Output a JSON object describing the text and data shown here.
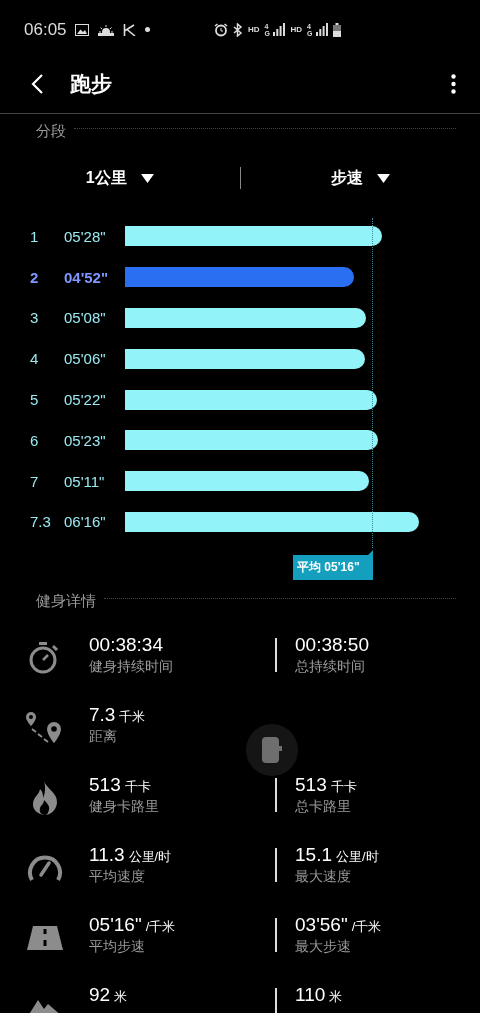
{
  "status_bar": {
    "time": "06:05",
    "left_icons": [
      {
        "kind": "image"
      },
      {
        "kind": "weather"
      },
      {
        "kind": "k"
      },
      {
        "kind": "dot"
      }
    ],
    "right_items": [
      {
        "kind": "alarm"
      },
      {
        "kind": "bluetooth"
      },
      {
        "kind": "hd",
        "text": "HD"
      },
      {
        "kind": "signal",
        "text": "4G"
      },
      {
        "kind": "hd",
        "text": "HD"
      },
      {
        "kind": "signal",
        "text": "4G"
      },
      {
        "kind": "battery"
      }
    ]
  },
  "header": {
    "title": "跑步"
  },
  "splits": {
    "title": "分段",
    "filters": [
      {
        "label": "1公里"
      },
      {
        "label": "步速"
      }
    ],
    "rows": [
      {
        "index": "1",
        "pace": "05'28\"",
        "selected": false
      },
      {
        "index": "2",
        "pace": "04'52\"",
        "selected": true
      },
      {
        "index": "3",
        "pace": "05'08\"",
        "selected": false
      },
      {
        "index": "4",
        "pace": "05'06\"",
        "selected": false
      },
      {
        "index": "5",
        "pace": "05'22\"",
        "selected": false
      },
      {
        "index": "6",
        "pace": "05'23\"",
        "selected": false
      },
      {
        "index": "7",
        "pace": "05'11\"",
        "selected": false
      },
      {
        "index": "7.3",
        "pace": "06'16\"",
        "selected": false
      }
    ],
    "average": {
      "label": "平均 05'16\""
    }
  },
  "details": {
    "title": "健身详情",
    "rows": [
      {
        "kind": "stopwatch",
        "left": {
          "value": "00:38:34",
          "label": "健身持续时间"
        },
        "right": {
          "value": "00:38:50",
          "label": "总持续时间"
        }
      },
      {
        "kind": "route",
        "left": {
          "value": "7.3",
          "unit": "千米",
          "label": "距离"
        }
      },
      {
        "kind": "flame",
        "left": {
          "value": "513",
          "unit": "千卡",
          "label": "健身卡路里"
        },
        "right": {
          "value": "513",
          "unit": "千卡",
          "label": "总卡路里"
        }
      },
      {
        "kind": "speedometer",
        "left": {
          "value": "11.3",
          "unit": "公里/时",
          "label": "平均速度"
        },
        "right": {
          "value": "15.1",
          "unit": "公里/时",
          "label": "最大速度"
        }
      },
      {
        "kind": "road",
        "left": {
          "value": "05'16\"",
          "unit": "/千米",
          "label": "平均步速"
        },
        "right": {
          "value": "03'56\"",
          "unit": "/千米",
          "label": "最大步速"
        }
      },
      {
        "kind": "mountain",
        "left": {
          "value": "92",
          "unit": "米"
        },
        "right": {
          "value": "110",
          "unit": "米"
        }
      }
    ]
  }
}
